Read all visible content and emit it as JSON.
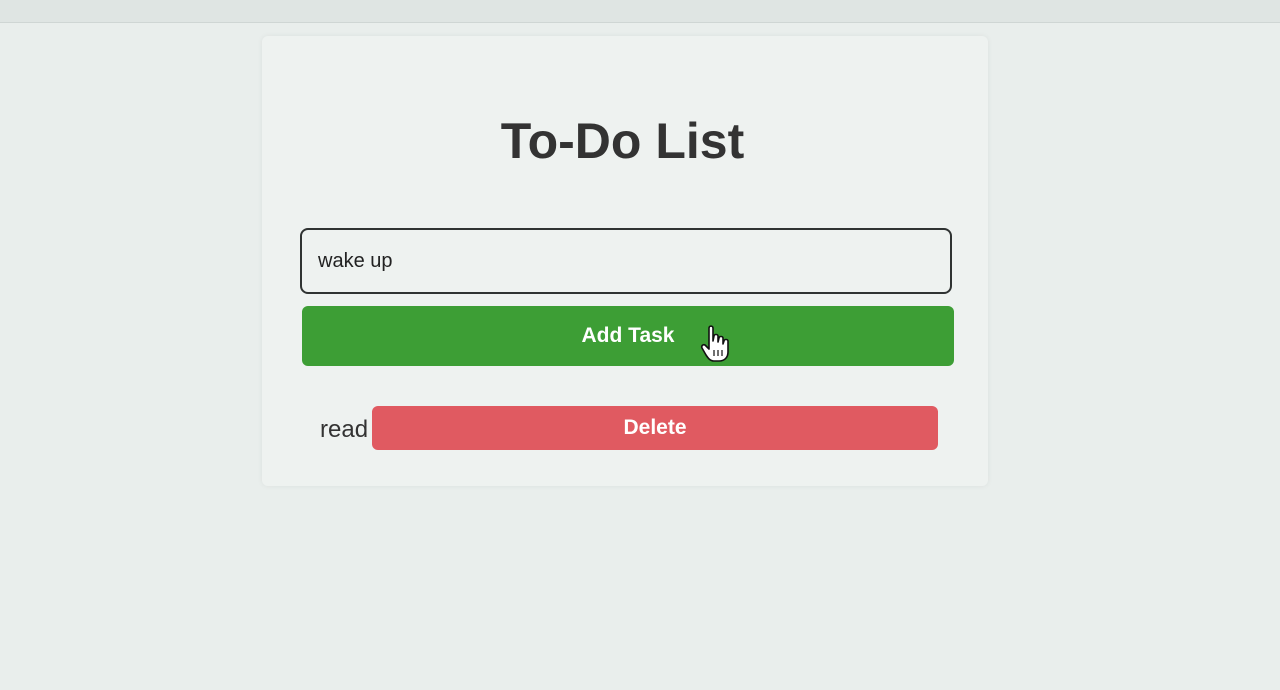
{
  "app": {
    "title": "To-Do List"
  },
  "input": {
    "value": "wake up"
  },
  "add_button": {
    "label": "Add Task"
  },
  "tasks": [
    {
      "text": "read",
      "delete_label": "Delete"
    }
  ],
  "icons": {
    "cursor": "hand-pointer-icon"
  },
  "colors": {
    "add_button": "#3d9e35",
    "delete_button": "#e05a61",
    "text": "#333333"
  }
}
